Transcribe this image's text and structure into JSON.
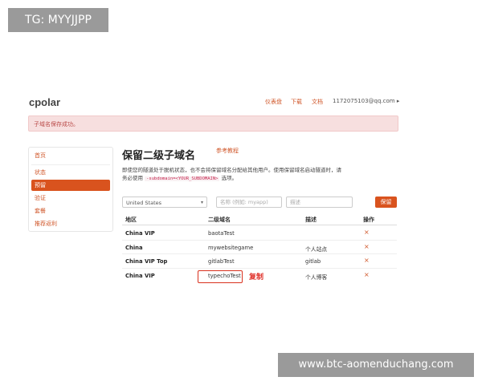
{
  "watermarks": {
    "top_left": "TG: MYYJJPP",
    "bottom_right": "www.btc-aomenduchang.com"
  },
  "header": {
    "logo": "cpolar",
    "nav": {
      "dashboard": "仪表盘",
      "download": "下载",
      "docs": "文档",
      "user": "1172075103@qq.com ▸"
    }
  },
  "alert": {
    "text": "子域名保存成功。"
  },
  "sidebar": {
    "items": [
      {
        "label": "首页",
        "active": false
      },
      {
        "label": "状态",
        "active": false
      },
      {
        "label": "预留",
        "active": true
      },
      {
        "label": "验证",
        "active": false
      },
      {
        "label": "套餐",
        "active": false
      },
      {
        "label": "推荐返利",
        "active": false
      }
    ]
  },
  "main": {
    "title": "保留二级子域名",
    "ref_link": "参考教程",
    "desc_part1": "即使您的隧道处于脱机状态，也不会将保留域名分配给其他用户。使用保留域名启动隧道时，请务必使用",
    "desc_code": "-subdomain=<YOUR_SUBDOMAIN>",
    "desc_part2": "选项。"
  },
  "form": {
    "region_value": "United States",
    "name_placeholder": "名称 (例如: myapp)",
    "desc_placeholder": "描述",
    "save_label": "保留"
  },
  "table": {
    "headers": {
      "region": "地区",
      "subdomain": "二级域名",
      "description": "描述",
      "actions": "操作"
    },
    "rows": [
      {
        "region": "China VIP",
        "subdomain": "baotaTest",
        "description": "",
        "action": "×"
      },
      {
        "region": "China",
        "subdomain": "mywebsitegame",
        "description": "个人站点",
        "action": "×"
      },
      {
        "region": "China VIP Top",
        "subdomain": "gitlabTest",
        "description": "gitlab",
        "action": "×"
      },
      {
        "region": "China VIP",
        "subdomain": "typechoTest",
        "description": "个人博客",
        "action": "×"
      }
    ]
  },
  "annotation": {
    "copy_label": "复制"
  },
  "colors": {
    "accent": "#d9531e",
    "alert_bg": "#f7dfdf",
    "annotation_red": "#e0312a"
  }
}
